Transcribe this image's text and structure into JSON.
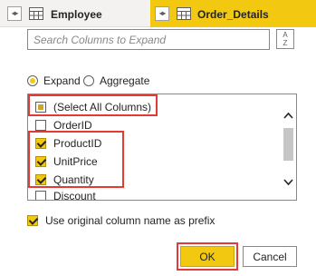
{
  "header": {
    "columns": [
      {
        "title": "Employee",
        "expand_icon": "expand-columns-icon",
        "type_icon": "table-icon"
      },
      {
        "title": "Order_Details",
        "expand_icon": "expand-columns-icon",
        "type_icon": "table-icon",
        "active": true
      }
    ],
    "active_tab_color": "#f2c811"
  },
  "search": {
    "placeholder": "Search Columns to Expand",
    "value": "",
    "sort_icon": "sort-az-icon",
    "sort_glyph_top": "A",
    "sort_glyph_bottom": "Z"
  },
  "mode": {
    "options": [
      {
        "label": "Expand",
        "selected": true
      },
      {
        "label": "Aggregate",
        "selected": false
      }
    ]
  },
  "columns_list": {
    "items": [
      {
        "label": "(Select All Columns)",
        "state": "partial"
      },
      {
        "label": "OrderID",
        "state": "unchecked"
      },
      {
        "label": "ProductID",
        "state": "checked"
      },
      {
        "label": "UnitPrice",
        "state": "checked"
      },
      {
        "label": "Quantity",
        "state": "checked"
      },
      {
        "label": "Discount",
        "state": "unchecked"
      }
    ],
    "scrollbar": {
      "up_icon": "chevron-up-icon",
      "down_icon": "chevron-down-icon"
    }
  },
  "prefix_option": {
    "label": "Use original column name as prefix",
    "checked": true
  },
  "buttons": {
    "ok": "OK",
    "cancel": "Cancel"
  },
  "colors": {
    "accent": "#f2c811",
    "highlight": "#e53935"
  }
}
